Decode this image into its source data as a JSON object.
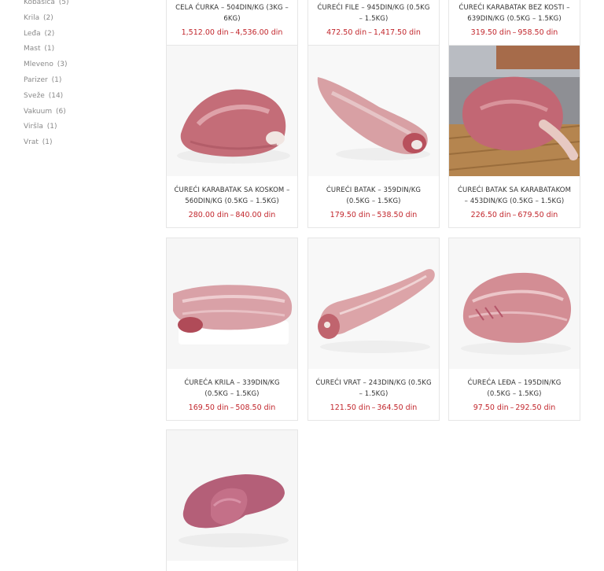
{
  "sidebar": {
    "categories": [
      {
        "label": "Kobasica",
        "count": "(5)"
      },
      {
        "label": "Krila",
        "count": "(2)"
      },
      {
        "label": "Leđa",
        "count": "(2)"
      },
      {
        "label": "Mast",
        "count": "(1)"
      },
      {
        "label": "Mleveno",
        "count": "(3)"
      },
      {
        "label": "Parizer",
        "count": "(1)"
      },
      {
        "label": "Sveže",
        "count": "(14)"
      },
      {
        "label": "Vakuum",
        "count": "(6)"
      },
      {
        "label": "Viršla",
        "count": "(1)"
      },
      {
        "label": "Vrat",
        "count": "(1)"
      }
    ]
  },
  "products": [
    {
      "title": "CELA ĆURKA – 504DIN/KG (3KG – 6KG)",
      "price_min": "1,512.00 din",
      "price_max": "4,536.00 din",
      "image": "whole-turkey"
    },
    {
      "title": "ĆUREĆI FILE – 945DIN/KG (0.5KG – 1.5KG)",
      "price_min": "472.50 din",
      "price_max": "1,417.50 din",
      "image": "turkey-fillet"
    },
    {
      "title": "ĆUREĆI KARABATAK BEZ KOSTI – 639DIN/KG (0.5KG – 1.5KG)",
      "price_min": "319.50 din",
      "price_max": "958.50 din",
      "image": "boneless-thigh"
    },
    {
      "title": "ĆUREĆI KARABATAK SA KOSKOM – 560DIN/KG (0.5KG – 1.5KG)",
      "price_min": "280.00 din",
      "price_max": "840.00 din",
      "image": "thigh-with-bone"
    },
    {
      "title": "ĆUREĆI BATAK – 359DIN/KG (0.5KG – 1.5KG)",
      "price_min": "179.50 din",
      "price_max": "538.50 din",
      "image": "drumstick"
    },
    {
      "title": "ĆUREĆI BATAK SA KARABATAKOM – 453DIN/KG (0.5KG – 1.5KG)",
      "price_min": "226.50 din",
      "price_max": "679.50 din",
      "image": "leg-quarter"
    },
    {
      "title": "ĆUREĆA KRILA – 339DIN/KG (0.5KG – 1.5KG)",
      "price_min": "169.50 din",
      "price_max": "508.50 din",
      "image": "wings"
    },
    {
      "title": "ĆUREĆI VRAT – 243DIN/KG (0.5KG – 1.5KG)",
      "price_min": "121.50 din",
      "price_max": "364.50 din",
      "image": "neck"
    },
    {
      "title": "ĆUREĆA LEĐA – 195DIN/KG (0.5KG – 1.5KG)",
      "price_min": "97.50 din",
      "price_max": "292.50 din",
      "image": "back"
    },
    {
      "title": "",
      "price_min": "",
      "price_max": "",
      "image": "liver"
    }
  ],
  "price_separator": "–",
  "colors": {
    "price": "#c2272d",
    "border": "#e6e6e6",
    "meat": "#c9707a"
  }
}
